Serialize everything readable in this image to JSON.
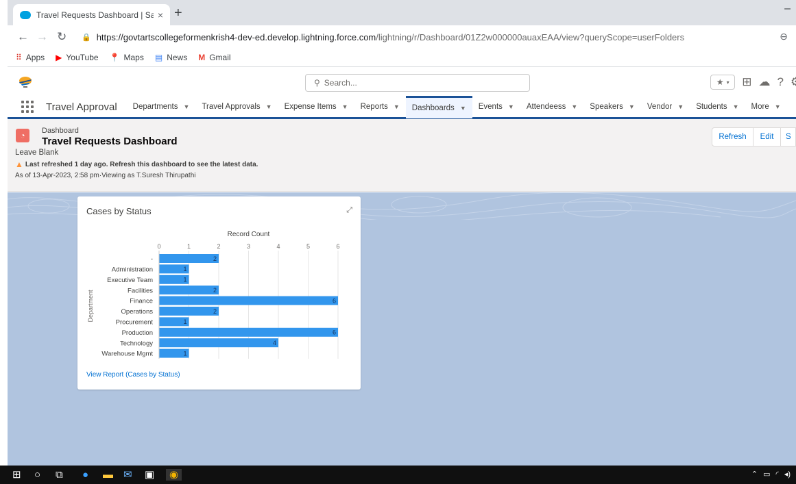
{
  "browser": {
    "tab_title": "Travel Requests Dashboard | Sale",
    "close_glyph": "×",
    "new_tab_glyph": "+",
    "minimize_glyph": "–",
    "url_host": "https://govtartscollegeformenkrish4-dev-ed.develop.lightning.force.com",
    "url_path": "/lightning/r/Dashboard/01Z2w000000auaxEAA/view?queryScope=userFolders",
    "bookmarks": [
      {
        "label": "Apps",
        "icon": "apps-grid-icon",
        "color": "#d93025"
      },
      {
        "label": "YouTube",
        "icon": "youtube-icon",
        "color": "#ff0000"
      },
      {
        "label": "Maps",
        "icon": "maps-pin-icon",
        "color": "#34a853"
      },
      {
        "label": "News",
        "icon": "news-icon",
        "color": "#4285f4"
      },
      {
        "label": "Gmail",
        "icon": "gmail-icon",
        "color": "#ea4335"
      }
    ]
  },
  "header": {
    "search_placeholder": "Search..."
  },
  "nav": {
    "app_name": "Travel Approval",
    "items": [
      {
        "label": "Departments",
        "active": false
      },
      {
        "label": "Travel Approvals",
        "active": false
      },
      {
        "label": "Expense Items",
        "active": false
      },
      {
        "label": "Reports",
        "active": false
      },
      {
        "label": "Dashboards",
        "active": true
      },
      {
        "label": "Events",
        "active": false
      },
      {
        "label": "Attendeess",
        "active": false
      },
      {
        "label": "Speakers",
        "active": false
      },
      {
        "label": "Vendor",
        "active": false
      },
      {
        "label": "Students",
        "active": false
      }
    ],
    "more_label": "More"
  },
  "page": {
    "object_label": "Dashboard",
    "title": "Travel Requests Dashboard",
    "subtitle": "Leave Blank",
    "warning": "Last refreshed 1 day ago. Refresh this dashboard to see the latest data.",
    "as_of": "As of 13-Apr-2023, 2:58 pm·Viewing as T.Suresh Thirupathi",
    "refresh_label": "Refresh",
    "edit_label": "Edit",
    "third_label": "S"
  },
  "card": {
    "title": "Cases by Status",
    "link": "View Report (Cases by Status)"
  },
  "colors": {
    "bar": "#3296ed",
    "accent": "#0070d2",
    "nav_active": "#1b5297",
    "background": "#b0c4df"
  },
  "chart_data": {
    "type": "bar",
    "orientation": "horizontal",
    "title": "Cases by Status",
    "xlabel": "Record Count",
    "ylabel": "Department",
    "xlim": [
      0,
      6
    ],
    "xticks": [
      0,
      1,
      2,
      3,
      4,
      5,
      6
    ],
    "categories": [
      "-",
      "Administration",
      "Executive Team",
      "Facilities",
      "Finance",
      "Operations",
      "Procurement",
      "Production",
      "Technology",
      "Warehouse Mgmt"
    ],
    "values": [
      2,
      1,
      1,
      2,
      6,
      2,
      1,
      6,
      4,
      1
    ]
  }
}
